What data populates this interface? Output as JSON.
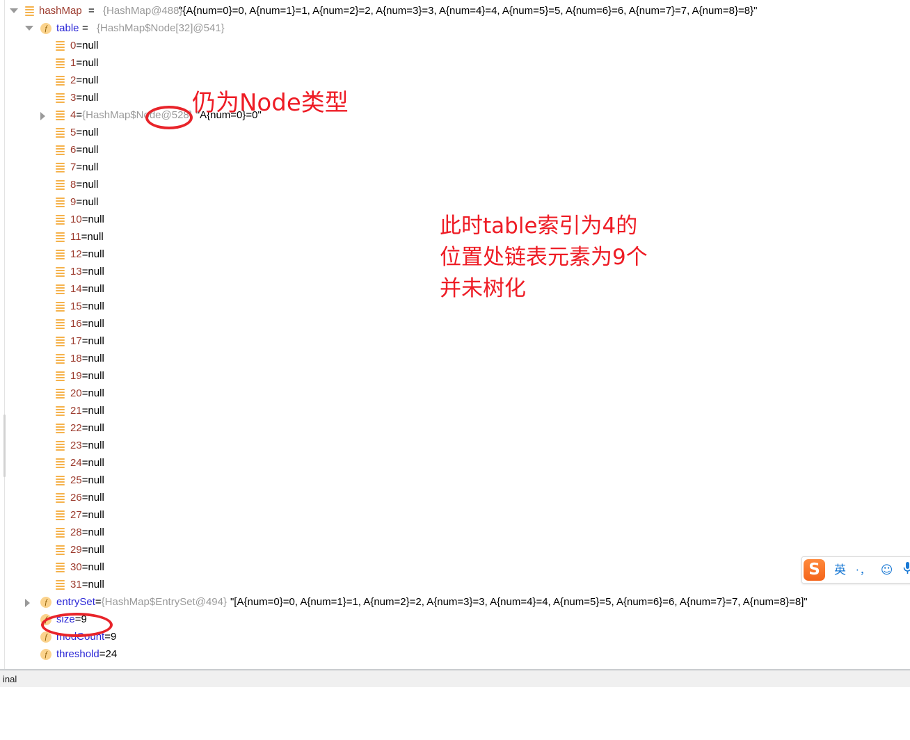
{
  "panel": {
    "name": "debugger-variables-panel",
    "root": {
      "label": "hashMap",
      "eq": " = ",
      "type": "{HashMap@488}",
      "value": "\"{A{num=0}=0, A{num=1}=1, A{num=2}=2, A{num=3}=3, A{num=4}=4, A{num=5}=5, A{num=6}=6, A{num=7}=7, A{num=8}=8}\""
    },
    "table_node": {
      "label": "table",
      "eq": " = ",
      "type": "{HashMap$Node[32]@541}"
    },
    "array_rows": [
      {
        "index": "0",
        "eq": " = ",
        "value": "null"
      },
      {
        "index": "1",
        "eq": " = ",
        "value": "null"
      },
      {
        "index": "2",
        "eq": " = ",
        "value": "null"
      },
      {
        "index": "3",
        "eq": " = ",
        "value": "null"
      },
      {
        "index": "4",
        "eq": " = ",
        "type": "{HashMap$Node@528}",
        "value": "\"A{num=0}=0\"",
        "expandable": true
      },
      {
        "index": "5",
        "eq": " = ",
        "value": "null"
      },
      {
        "index": "6",
        "eq": " = ",
        "value": "null"
      },
      {
        "index": "7",
        "eq": " = ",
        "value": "null"
      },
      {
        "index": "8",
        "eq": " = ",
        "value": "null"
      },
      {
        "index": "9",
        "eq": " = ",
        "value": "null"
      },
      {
        "index": "10",
        "eq": " = ",
        "value": "null"
      },
      {
        "index": "11",
        "eq": " = ",
        "value": "null"
      },
      {
        "index": "12",
        "eq": " = ",
        "value": "null"
      },
      {
        "index": "13",
        "eq": " = ",
        "value": "null"
      },
      {
        "index": "14",
        "eq": " = ",
        "value": "null"
      },
      {
        "index": "15",
        "eq": " = ",
        "value": "null"
      },
      {
        "index": "16",
        "eq": " = ",
        "value": "null"
      },
      {
        "index": "17",
        "eq": " = ",
        "value": "null"
      },
      {
        "index": "18",
        "eq": " = ",
        "value": "null"
      },
      {
        "index": "19",
        "eq": " = ",
        "value": "null"
      },
      {
        "index": "20",
        "eq": " = ",
        "value": "null"
      },
      {
        "index": "21",
        "eq": " = ",
        "value": "null"
      },
      {
        "index": "22",
        "eq": " = ",
        "value": "null"
      },
      {
        "index": "23",
        "eq": " = ",
        "value": "null"
      },
      {
        "index": "24",
        "eq": " = ",
        "value": "null"
      },
      {
        "index": "25",
        "eq": " = ",
        "value": "null"
      },
      {
        "index": "26",
        "eq": " = ",
        "value": "null"
      },
      {
        "index": "27",
        "eq": " = ",
        "value": "null"
      },
      {
        "index": "28",
        "eq": " = ",
        "value": "null"
      },
      {
        "index": "29",
        "eq": " = ",
        "value": "null"
      },
      {
        "index": "30",
        "eq": " = ",
        "value": "null"
      },
      {
        "index": "31",
        "eq": " = ",
        "value": "null"
      }
    ],
    "fields": [
      {
        "label": "entrySet",
        "eq": " = ",
        "type": "{HashMap$EntrySet@494}",
        "value": "\"[A{num=0}=0, A{num=1}=1, A{num=2}=2, A{num=3}=3, A{num=4}=4, A{num=5}=5, A{num=6}=6, A{num=7}=7, A{num=8}=8]\"",
        "expandable": true
      },
      {
        "label": "size",
        "eq": " = ",
        "value": "9"
      },
      {
        "label": "modCount",
        "eq": " = ",
        "value": "9"
      },
      {
        "label": "threshold",
        "eq": " = ",
        "value": "24"
      }
    ]
  },
  "annotations": {
    "node_type": "仍为Node类型",
    "block_line1": "此时table索引为4的",
    "block_line2": "位置处链表元素为9个",
    "block_line3": "并未树化",
    "color": "#ee1c25"
  },
  "status_bar": {
    "text": "inal"
  },
  "ime": {
    "logo": "S",
    "language_mode": "英",
    "punctuation": "·，",
    "emoji": "☺",
    "mic": "mic"
  },
  "colors": {
    "accent_orange": "#f5b24c",
    "field_name_blue": "#2a26d6",
    "array_index_red": "#9c3b2e",
    "type_gray": "#9a9a9a",
    "annotation_red": "#ee1c25"
  }
}
